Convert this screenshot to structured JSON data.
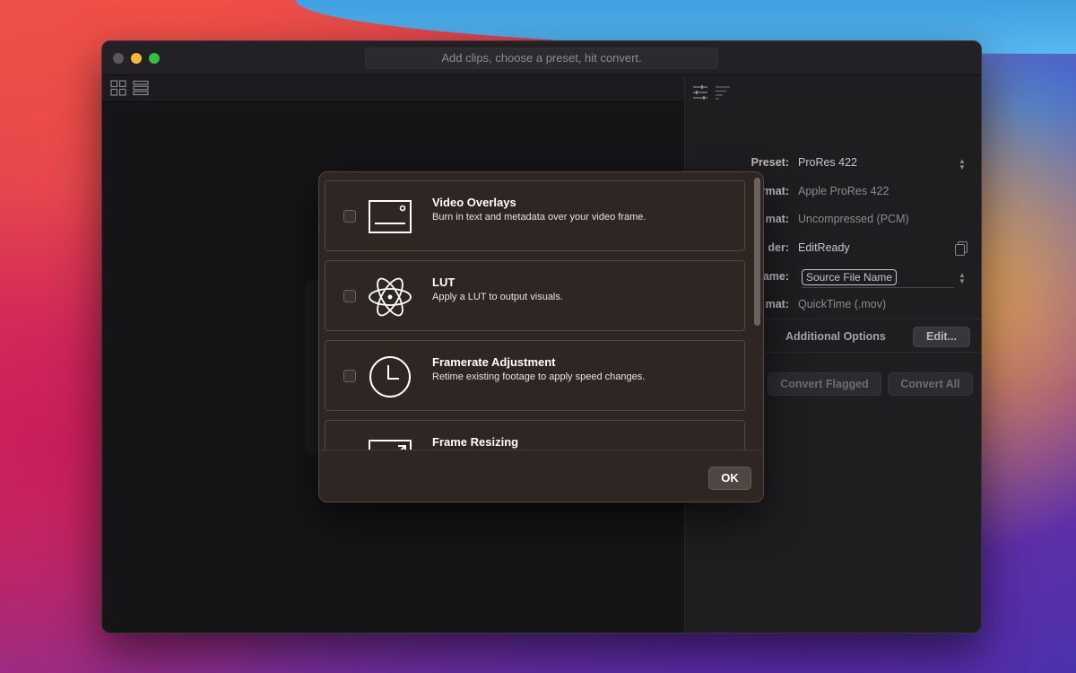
{
  "window": {
    "title_hint": "Add clips, choose a preset, hit convert."
  },
  "settings": {
    "preset_label": "Preset:",
    "preset_value": "ProRes 422",
    "video_format_label": "Video Format:",
    "video_format_value": "Apple ProRes 422",
    "audio_format_label": "mat:",
    "audio_format_value": "Uncompressed (PCM)",
    "folder_label": "der:",
    "folder_value": "EditReady",
    "filename_label": "ame:",
    "filename_token": "Source File Name",
    "container_label": "mat:",
    "container_value": "QuickTime (.mov)",
    "additional_options_label": "Additional Options",
    "edit_button": "Edit...",
    "convert_flagged_button": "Convert Flagged",
    "convert_all_button": "Convert All"
  },
  "sheet": {
    "options": [
      {
        "title": "Video Overlays",
        "description": "Burn in text and metadata over your video frame.",
        "icon": "video-overlay-icon",
        "checked": false
      },
      {
        "title": "LUT",
        "description": "Apply a LUT to output visuals.",
        "icon": "atom-icon",
        "checked": false
      },
      {
        "title": "Framerate Adjustment",
        "description": "Retime existing footage to apply speed changes.",
        "icon": "clock-icon",
        "checked": false
      },
      {
        "title": "Frame Resizing",
        "description": "",
        "icon": "resize-icon",
        "checked": false
      }
    ],
    "ok_button": "OK"
  }
}
